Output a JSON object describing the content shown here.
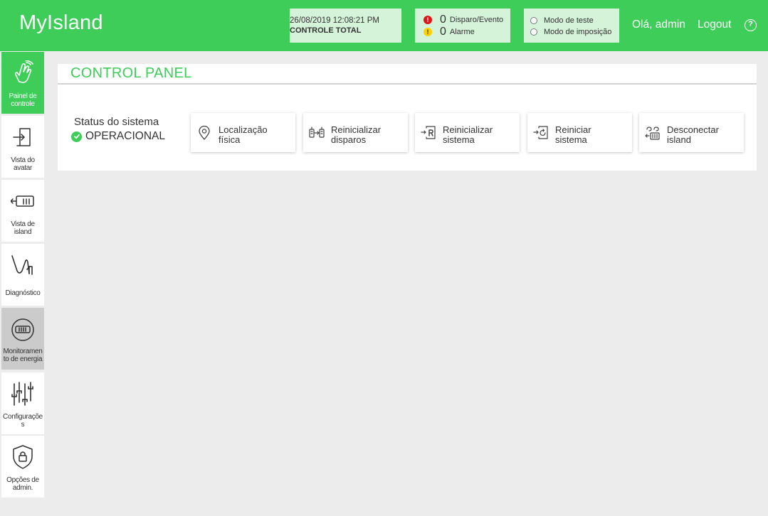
{
  "header": {
    "app_title": "MyIsland",
    "datetime": "26/08/2019 12:08:21 PM",
    "control_mode": "CONTROLE TOTAL",
    "events": [
      {
        "count": "0",
        "label": "Disparo/Evento",
        "icon": "exclamation-red-icon"
      },
      {
        "count": "0",
        "label": "Alarme",
        "icon": "exclamation-yellow-icon"
      }
    ],
    "modes": [
      {
        "label": "Modo de teste"
      },
      {
        "label": "Modo de imposição"
      }
    ],
    "greeting": "Olá, admin",
    "logout": "Logout",
    "help": "?"
  },
  "sidebar": {
    "items": [
      {
        "label_line1": "Painel de",
        "label_line2": "controle",
        "icon": "hand-pointer-icon",
        "active": true
      },
      {
        "label_line1": "Vista do",
        "label_line2": "avatar",
        "icon": "enter-door-icon"
      },
      {
        "label_line1": "Vista de",
        "label_line2": "island",
        "icon": "island-module-icon"
      },
      {
        "label_line1": "Diagnóstico",
        "label_line2": "",
        "icon": "stethoscope-icon"
      },
      {
        "label_line1": "Monitoramen",
        "label_line2": "to de energia",
        "icon": "energy-meter-icon"
      },
      {
        "label_line1": "Configuraçõe",
        "label_line2": "s",
        "icon": "sliders-icon"
      },
      {
        "label_line1": "Opções de",
        "label_line2": "admin.",
        "icon": "shield-lock-icon"
      }
    ]
  },
  "panel": {
    "title": "CONTROL PANEL",
    "status_label": "Status do sistema",
    "status_value": "OPERACIONAL",
    "actions": [
      {
        "line1": "Localização",
        "line2": "física",
        "icon": "location-pin-icon"
      },
      {
        "line1": "Reinicializar",
        "line2": "disparos",
        "icon": "reset-trips-icon"
      },
      {
        "line1": "Reinicializar",
        "line2": "sistema",
        "icon": "reset-system-icon"
      },
      {
        "line1": "Reiniciar",
        "line2": "sistema",
        "icon": "restart-system-icon"
      },
      {
        "line1": "Desconectar",
        "line2": "island",
        "icon": "disconnect-island-icon"
      }
    ]
  },
  "colors": {
    "brand_green": "#3dcd58",
    "status_box_bg": "#d4f3d9",
    "error_red": "#e0151b",
    "alarm_yellow": "#ffd100",
    "background": "#ececec"
  }
}
